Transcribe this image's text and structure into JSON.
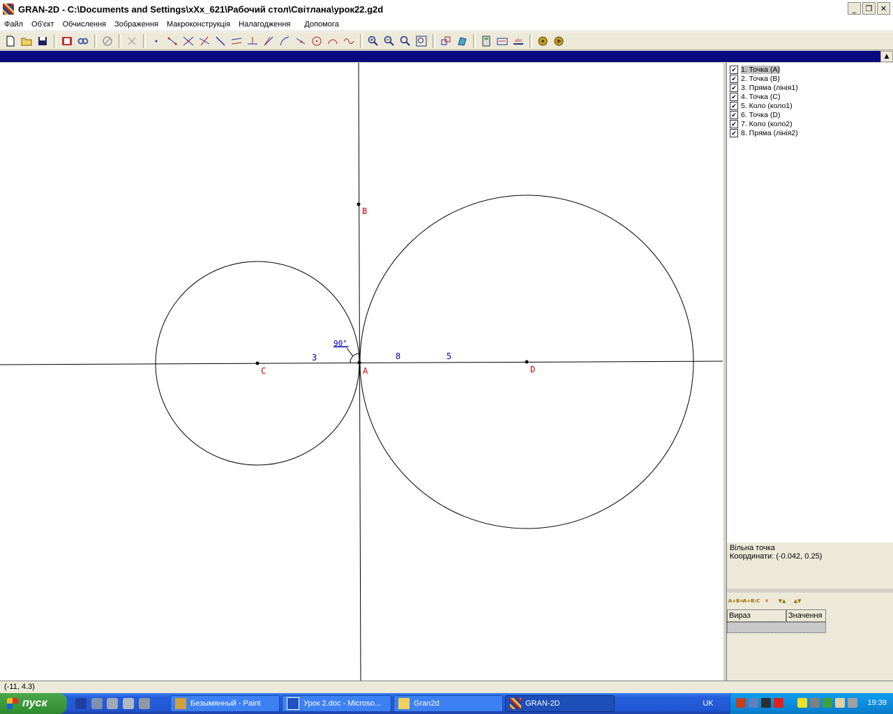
{
  "window": {
    "title": "GRAN-2D - C:\\Documents and Settings\\xXx_621\\Рабочий стол\\Світлана\\урок22.g2d",
    "minimize": "_",
    "restore": "❐",
    "close": "✕"
  },
  "menu": [
    "Файл",
    "Об'єкт",
    "Обчислення",
    "Зображення",
    "Макроконструкція",
    "Налагодження",
    "Допомога"
  ],
  "toolbar_icons": [
    "new-file-icon",
    "open-folder-icon",
    "save-icon",
    "film-icon",
    "link-icon",
    "disabled-icon",
    "cut-icon",
    "point-icon",
    "segment-icon",
    "intersection-icon",
    "line-icon",
    "ray-icon",
    "parallel-icon",
    "perpendicular-icon",
    "bisector-icon",
    "tangent-icon",
    "vector-icon",
    "circle-icon",
    "arc-icon",
    "curve-icon",
    "zoom-in-icon",
    "zoom-out-icon",
    "zoom-icon",
    "zoom-fit-icon",
    "move-icon",
    "rotate-icon",
    "calculator-icon",
    "measure-icon",
    "ruler-icon",
    "macro-icon",
    "macro-run-icon"
  ],
  "canvas": {
    "labels": {
      "A": "A",
      "B": "B",
      "C": "C",
      "D": "D",
      "angle": "90°",
      "seg3": "3",
      "seg8": "8",
      "seg5": "5"
    },
    "colors": {
      "point_label": "#cc0000",
      "measure": "#0000aa",
      "line": "#000000"
    }
  },
  "objects": [
    {
      "label": "1. Точка (A)",
      "checked": true,
      "selected": true
    },
    {
      "label": "2. Точка (B)",
      "checked": true
    },
    {
      "label": "3. Пряма (лінія1)",
      "checked": true
    },
    {
      "label": "4. Точка (C)",
      "checked": true
    },
    {
      "label": "5. Коло (коло1)",
      "checked": true
    },
    {
      "label": "6. Точка (D)",
      "checked": true
    },
    {
      "label": "7. Коло (коло2)",
      "checked": true
    },
    {
      "label": "8. Пряма (лінія2)",
      "checked": true
    }
  ],
  "info": {
    "line1": "Вільна точка",
    "line2": "Координати: (-0.042, 0.25)"
  },
  "expr_table": {
    "col1": "Вираз",
    "col2": "Значення"
  },
  "status": "(-11, 4.3)",
  "taskbar": {
    "start": "пуск",
    "tasks": [
      {
        "label": "Безымянный - Paint"
      },
      {
        "label": "Урок 2.doc - Microso..."
      },
      {
        "label": "Gran2d"
      },
      {
        "label": "GRAN-2D"
      }
    ],
    "lang": "UK",
    "clock": "19:39"
  }
}
